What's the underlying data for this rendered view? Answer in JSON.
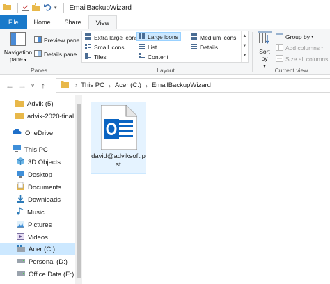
{
  "window": {
    "title": "EmailBackupWizard"
  },
  "tabs": [
    "File",
    "Home",
    "Share",
    "View"
  ],
  "ribbon": {
    "panes": {
      "label": "Panes",
      "navigation_pane": "Navigation pane",
      "preview_pane": "Preview pane",
      "details_pane": "Details pane"
    },
    "layout": {
      "label": "Layout",
      "items": [
        "Extra large icons",
        "Large icons",
        "Medium icons",
        "Small icons",
        "List",
        "Details",
        "Tiles",
        "Content"
      ],
      "selected": "Large icons"
    },
    "current_view": {
      "label": "Current view",
      "sort_by": "Sort by",
      "group_by": "Group by",
      "add_columns": "Add columns",
      "size_all_columns": "Size all columns to fit"
    }
  },
  "address": {
    "crumbs": [
      "This PC",
      "Acer (C:)",
      "EmailBackupWizard"
    ]
  },
  "nav": {
    "items": [
      "Advik (5)",
      "advik-2020-final",
      "OneDrive",
      "This PC",
      "3D Objects",
      "Desktop",
      "Documents",
      "Downloads",
      "Music",
      "Pictures",
      "Videos",
      "Acer (C:)",
      "Personal (D:)",
      "Office Data (E:)"
    ],
    "selected": "Acer (C:)"
  },
  "content": {
    "files": [
      {
        "name": "david@adviksoft.pst",
        "icon": "outlook-pst-icon"
      }
    ]
  },
  "colors": {
    "file_tab": "#1979ca",
    "selection": "#cce8ff",
    "outlook_blue": "#0a64c2"
  }
}
